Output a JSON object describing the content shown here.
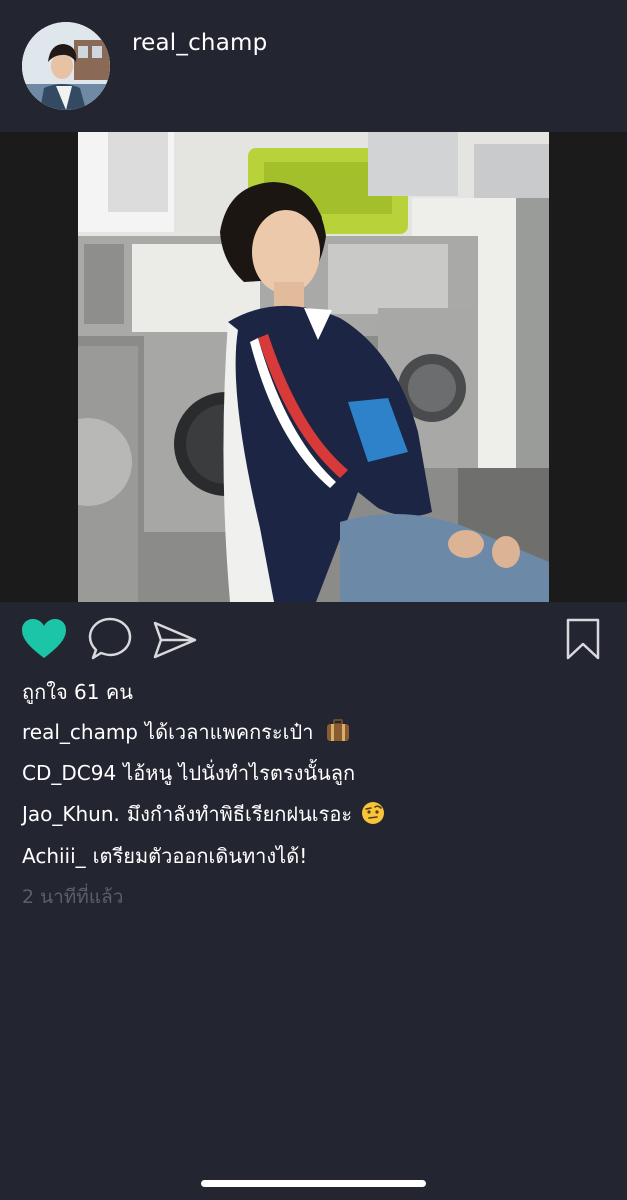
{
  "post": {
    "username": "real_champ",
    "likes_text": "ถูกใจ 61 คน",
    "liked": true,
    "timestamp": "2 นาทีที่แล้ว"
  },
  "comments": [
    {
      "user": "real_champ",
      "text": "ได้เวลาแพคกระเป๋า",
      "emoji": "luggage"
    },
    {
      "user": "CD_DC94",
      "text": "ไอ้หนู ไปนั่งทำไรตรงนั้นลูก"
    },
    {
      "user": "Jao_Khun.",
      "text": "มึงกำลังทำพิธีเรียกฝนเรอะ",
      "emoji": "raised-eyebrow-face"
    },
    {
      "user": "Achiii_",
      "text": "เตรียมตัวออกเดินทางได้!"
    }
  ],
  "icons": {
    "like": "heart-icon",
    "comment": "comment-bubble-icon",
    "share": "paper-plane-icon",
    "save": "bookmark-icon"
  },
  "colors": {
    "background": "#232530",
    "like_active": "#1cc5a5",
    "muted_text": "#5c5f69"
  }
}
